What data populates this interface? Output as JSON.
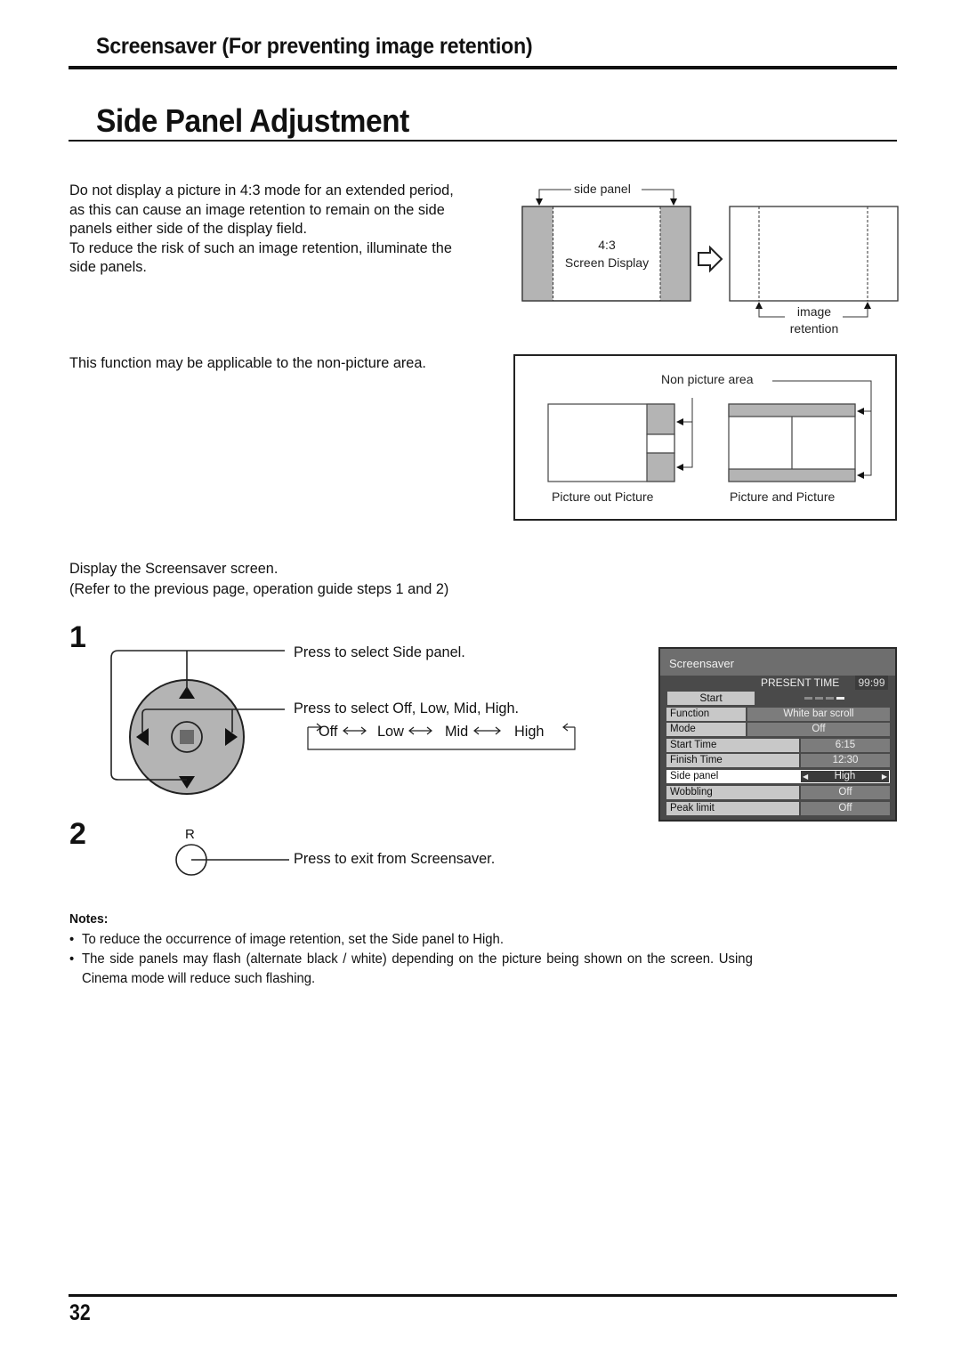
{
  "header": {
    "section_title": "Screensaver (For preventing image retention)",
    "page_title": "Side Panel Adjustment"
  },
  "intro": {
    "lines": [
      "Do not display a picture in 4:3 mode for an extended period,",
      "as this can cause an image retention to remain on the side",
      "panels either side of the display field.",
      "To reduce the risk of such an image retention, illuminate the",
      "side panels."
    ],
    "applicable_note": "This function may be applicable to the non-picture area."
  },
  "diagram_side_panel": {
    "side_panel_label": "side panel",
    "screen_label_line1": "4:3",
    "screen_label_line2": "Screen Display",
    "image_retention_line1": "image",
    "image_retention_line2": "retention",
    "panel_color": "#b4b4b4"
  },
  "diagram_non_picture": {
    "label": "Non picture area",
    "left_caption": "Picture out Picture",
    "right_caption": "Picture and Picture"
  },
  "instructions": {
    "line1": "Display the Screensaver screen.",
    "line2": "(Refer to the previous page, operation guide steps 1 and 2)"
  },
  "step1": {
    "number": "1",
    "press_up_down": "Press to select Side panel.",
    "press_left_right": "Press to select Off, Low, Mid, High.",
    "cycle_options": [
      "Off",
      "Low",
      "Mid",
      "High"
    ]
  },
  "step2": {
    "number": "2",
    "button_label": "R",
    "press_exit": "Press to exit from Screensaver."
  },
  "osd_menu": {
    "title": "Screensaver",
    "present_time_label": "PRESENT  TIME",
    "present_time_value": "99:99",
    "start_label": "Start",
    "rows": [
      {
        "label": "Function",
        "value": "White bar scroll"
      },
      {
        "label": "Mode",
        "value": "Off"
      },
      {
        "label": "Start Time",
        "value": "6:15"
      },
      {
        "label": "Finish Time",
        "value": "12:30"
      },
      {
        "label": "Side panel",
        "value": "High",
        "selected": true
      },
      {
        "label": "Wobbling",
        "value": "Off"
      },
      {
        "label": "Peak limit",
        "value": "Off"
      }
    ]
  },
  "notes": {
    "title": "Notes:",
    "items": [
      "To reduce the occurrence of image retention, set the Side panel to High.",
      "The side panels may flash (alternate black / white) depending on the picture being shown on the screen. Using",
      "Cinema mode will reduce such flashing."
    ]
  },
  "footer": {
    "page_number": "32"
  }
}
